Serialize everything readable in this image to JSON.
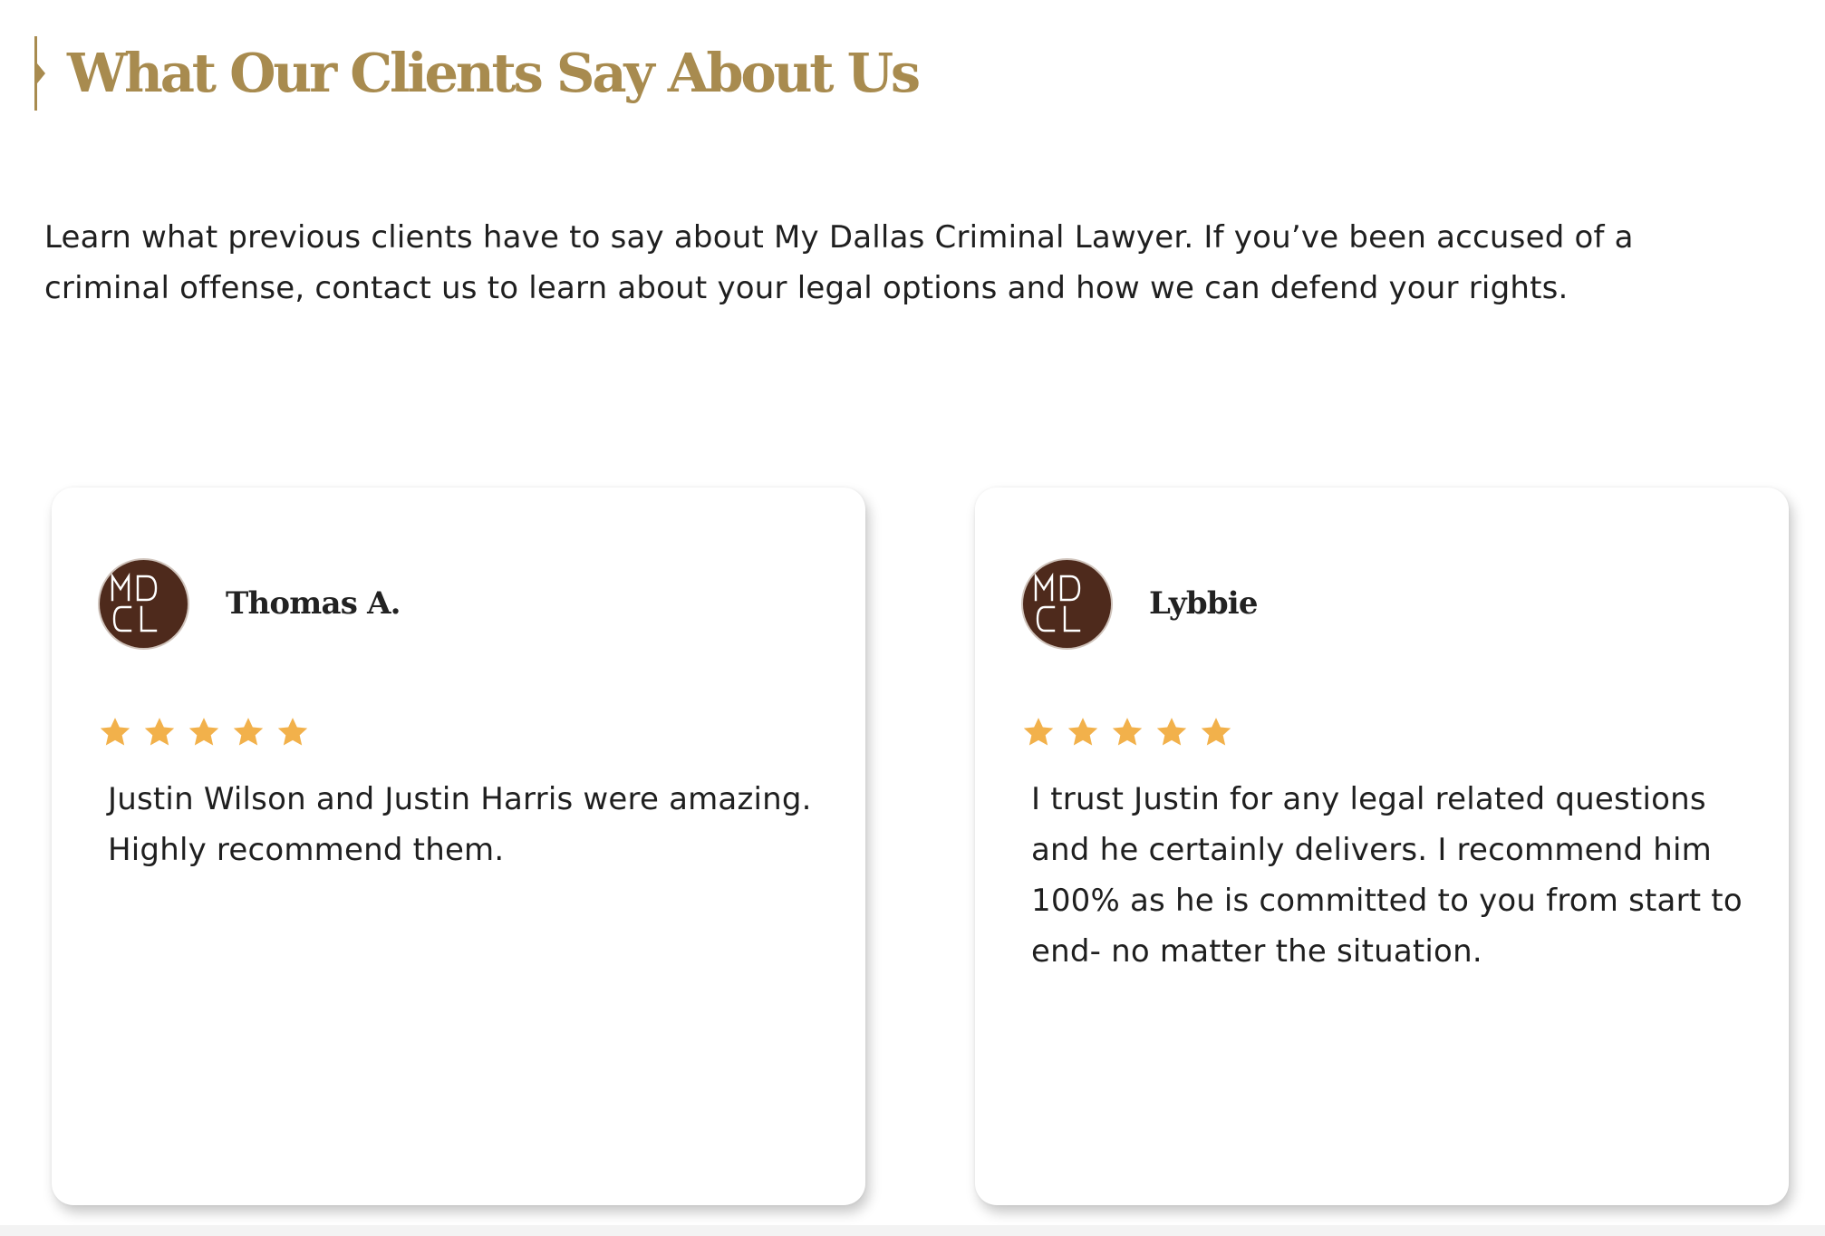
{
  "section": {
    "title": "What Our Clients Say About Us",
    "intro": "Learn what previous clients have to say about My Dallas Criminal Lawyer. If you’ve been accused of a criminal offense, contact us to learn about your legal options and how we can defend your rights."
  },
  "colors": {
    "accent": "#a88b4f",
    "star": "#f2b14b",
    "avatar_bg": "#4e2a1c",
    "text": "#1f1f1f"
  },
  "reviews": [
    {
      "name": "Thomas A.",
      "avatar_logo": [
        "MD",
        "CL"
      ],
      "rating": 5,
      "text": "Justin Wilson and Justin Harris were amazing. Highly recommend them."
    },
    {
      "name": "Lybbie",
      "avatar_logo": [
        "MD",
        "CL"
      ],
      "rating": 5,
      "text": "I trust Justin for any legal related questions and he certainly delivers. I recommend him 100% as he is committed to you from start to end- no matter the situation."
    }
  ]
}
